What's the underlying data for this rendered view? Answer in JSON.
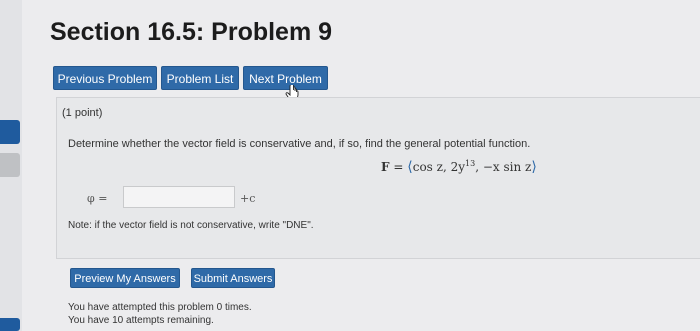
{
  "page_title": "Section 16.5: Problem 9",
  "nav": {
    "previous_label": "Previous Problem",
    "list_label": "Problem List",
    "next_label": "Next Problem"
  },
  "problem": {
    "points": "(1 point)",
    "question": "Determine whether the vector field is conservative and, if so, find the general potential function.",
    "formula": {
      "lhs": "F",
      "eq": "=",
      "open": "⟨",
      "part1": "cos z, 2y",
      "exponent": "13",
      "part2": ", −x sin z",
      "close": "⟩"
    },
    "phi_label": "φ =",
    "answer_value": "",
    "plus_c": "+c",
    "note": "Note: if the vector field is not conservative, write \"DNE\"."
  },
  "actions": {
    "preview_label": "Preview My Answers",
    "submit_label": "Submit Answers"
  },
  "status": {
    "attempted": "You have attempted this problem 0 times.",
    "remaining": "You have 10 attempts remaining."
  },
  "colors": {
    "accent": "#2f6aa8",
    "background": "#ececee"
  }
}
